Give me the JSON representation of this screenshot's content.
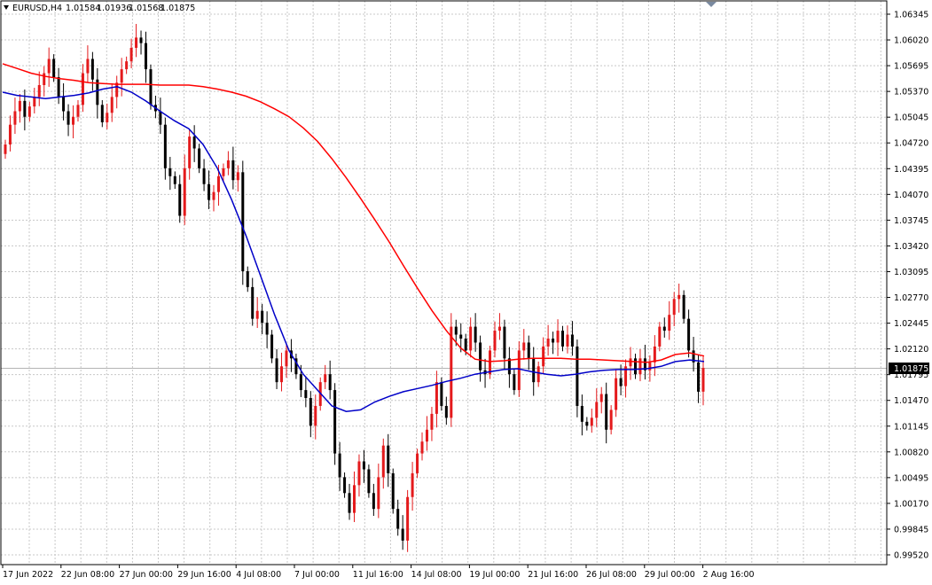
{
  "header": {
    "symbol": "EURUSD,H4",
    "open": "1.01584",
    "high": "1.01936",
    "low": "1.01568",
    "close": "1.01875"
  },
  "colors": {
    "bull": "#e41a1c",
    "bear": "#000000",
    "ma_slow": "#ff0000",
    "ma_fast": "#0000c8",
    "grid": "#c8c8c8",
    "price_line": "#b4b4b4",
    "price_tag_bg": "#000000",
    "price_tag_text": "#ffffff"
  },
  "chart_data": {
    "type": "candlestick",
    "title": "EURUSD,H4",
    "ylim": [
      0.9935,
      1.0656
    ],
    "y_ticks": [
      "1.06345",
      "1.06020",
      "1.05695",
      "1.05370",
      "1.05045",
      "1.04720",
      "1.04395",
      "1.04070",
      "1.03745",
      "1.03420",
      "1.03095",
      "1.02770",
      "1.02445",
      "1.02120",
      "1.01795",
      "1.01470",
      "1.01145",
      "1.00820",
      "1.00495",
      "1.00170",
      "0.99845",
      "0.99520"
    ],
    "x_ticks": [
      "17 Jun 2022",
      "22 Jun 08:00",
      "27 Jun 00:00",
      "29 Jun 16:00",
      "4 Jul 08:00",
      "7 Jul 00:00",
      "11 Jul 16:00",
      "14 Jul 08:00",
      "19 Jul 00:00",
      "21 Jul 16:00",
      "26 Jul 08:00",
      "29 Jul 00:00",
      "2 Aug 16:00"
    ],
    "current_price": "1.01875",
    "grid": true,
    "candle_closes": [
      1.047,
      1.0495,
      1.0512,
      1.0525,
      1.0505,
      1.0518,
      1.053,
      1.0545,
      1.056,
      1.0578,
      1.0555,
      1.053,
      1.0512,
      1.0495,
      1.0505,
      1.052,
      1.056,
      1.0578,
      1.0552,
      1.052,
      1.0498,
      1.051,
      1.053,
      1.0548,
      1.0565,
      1.0575,
      1.0592,
      1.0605,
      1.0598,
      1.0565,
      1.052,
      1.0512,
      1.0495,
      1.044,
      1.043,
      1.042,
      1.038,
      1.044,
      1.048,
      1.0465,
      1.044,
      1.042,
      1.04,
      1.041,
      1.043,
      1.044,
      1.045,
      1.0425,
      1.0435,
      1.031,
      1.029,
      1.025,
      1.026,
      1.0245,
      1.023,
      1.02,
      1.017,
      1.019,
      1.021,
      1.02,
      1.018,
      1.016,
      1.015,
      1.0115,
      1.014,
      1.017,
      1.018,
      1.016,
      1.008,
      1.005,
      1.003,
      1.0005,
      1.004,
      1.007,
      1.006,
      1.003,
      1.001,
      1.005,
      1.009,
      1.0055,
      1.001,
      0.9985,
      0.997,
      1.0025,
      1.0055,
      1.008,
      1.0095,
      1.011,
      1.013,
      1.017,
      1.014,
      1.0125,
      1.024,
      1.023,
      1.0225,
      1.021,
      1.024,
      1.022,
      1.0185,
      1.018,
      1.021,
      1.0235,
      1.024,
      1.02,
      1.018,
      1.016,
      1.021,
      1.022,
      1.02,
      1.017,
      1.019,
      1.0215,
      1.0225,
      1.022,
      1.0235,
      1.0215,
      1.023,
      1.0215,
      1.014,
      1.012,
      1.0115,
      1.0125,
      1.0145,
      1.0155,
      1.011,
      1.0135,
      1.0175,
      1.0165,
      1.019,
      1.02,
      1.018,
      1.02,
      1.0185,
      1.0195,
      1.0215,
      1.024,
      1.0235,
      1.0255,
      1.0275,
      1.028,
      1.025,
      1.021,
      1.0195,
      1.0158,
      1.0188
    ],
    "series": [
      {
        "name": "",
        "color": "#ff0000",
        "values": [
          1.0572,
          1.0566,
          1.056,
          1.0556,
          1.0553,
          1.0551,
          1.0548,
          1.0547,
          1.0546,
          1.0546,
          1.0546,
          1.0545,
          1.0545,
          1.0545,
          1.0543,
          1.054,
          1.0536,
          1.0531,
          1.0524,
          1.0515,
          1.0505,
          1.0491,
          1.0474,
          1.0452,
          1.0428,
          1.0402,
          1.0375,
          1.0347,
          1.0317,
          1.0288,
          1.026,
          1.0235,
          1.0213,
          1.0199,
          1.0196,
          1.0197,
          1.0199,
          1.02,
          1.02,
          1.02,
          1.0199,
          1.0199,
          1.0198,
          1.0197,
          1.0196,
          1.0195,
          1.0198,
          1.0205,
          1.0207,
          1.0203
        ]
      },
      {
        "name": "",
        "color": "#0000c8",
        "values": [
          1.0536,
          1.0532,
          1.053,
          1.0528,
          1.053,
          1.0532,
          1.0535,
          1.054,
          1.0543,
          1.0536,
          1.0525,
          1.0512,
          1.05,
          1.049,
          1.047,
          1.044,
          1.04,
          1.0355,
          1.0305,
          1.0255,
          1.021,
          1.018,
          1.016,
          1.014,
          1.0133,
          1.0135,
          1.0145,
          1.0152,
          1.0158,
          1.0162,
          1.0166,
          1.0171,
          1.0175,
          1.018,
          1.0183,
          1.0186,
          1.0187,
          1.0183,
          1.018,
          1.0178,
          1.018,
          1.0183,
          1.0185,
          1.0186,
          1.0186,
          1.0187,
          1.019,
          1.0196,
          1.0198,
          1.0196
        ]
      }
    ]
  }
}
